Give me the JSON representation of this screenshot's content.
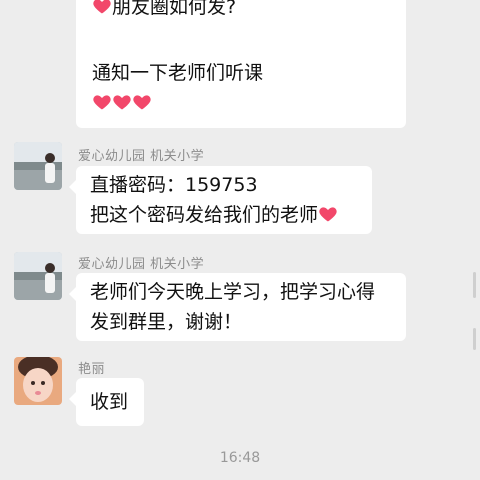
{
  "messages": [
    {
      "line1": "朋友圈如何发?",
      "line2": "通知一下老师们听课"
    },
    {
      "sender": "爱心幼儿园 机关小学",
      "line1": "直播密码：159753",
      "line2": "把这个密码发给我们的老师"
    },
    {
      "sender": "爱心幼儿园 机关小学",
      "line1": "老师们今天晚上学习，把学习心得",
      "line2": "发到群里，谢谢！"
    },
    {
      "sender": "艳丽",
      "line1": "收到"
    }
  ],
  "timestamp": "16:48",
  "colors": {
    "background": "#ededed",
    "bubble": "#ffffff",
    "heart": "#f2476a",
    "sender_text": "#8c8c8c"
  }
}
